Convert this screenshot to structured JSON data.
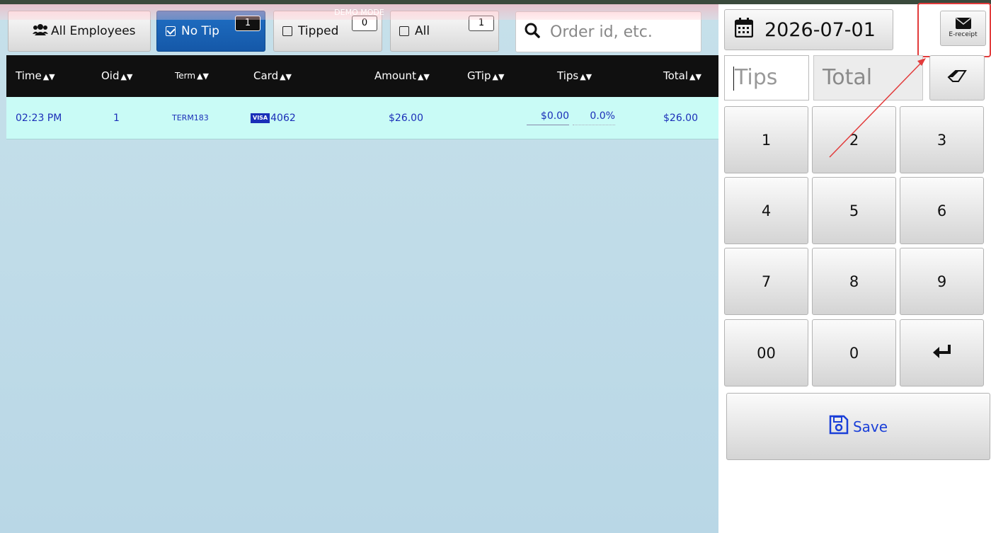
{
  "banner": {
    "text": "DEMO MODE"
  },
  "filters": {
    "all_employees": {
      "label": "All Employees"
    },
    "no_tip": {
      "label": "No Tip",
      "count": "1"
    },
    "tipped": {
      "label": "Tipped",
      "count": "0"
    },
    "all": {
      "label": "All",
      "count": "1"
    }
  },
  "search": {
    "placeholder": "Order id, etc."
  },
  "table": {
    "headers": [
      "Time",
      "Oid",
      "Term",
      "Card",
      "Amount",
      "GTip",
      "Tips",
      "Total"
    ],
    "rows": [
      {
        "time": "02:23 PM",
        "oid": "1",
        "term": "TERM183",
        "card_brand": "VISA",
        "card_last4": "4062",
        "amount": "$26.00",
        "gtip": "",
        "tips": "$0.00",
        "tip_percent": "0.0%",
        "total": "$26.00"
      }
    ]
  },
  "right_panel": {
    "date": "2026-07-01",
    "ereceipt_label": "E-receipt",
    "tips_placeholder": "Tips",
    "total_placeholder": "Total",
    "keypad": [
      "1",
      "2",
      "3",
      "4",
      "5",
      "6",
      "7",
      "8",
      "9",
      "00",
      "0",
      "enter"
    ],
    "save_label": "Save"
  },
  "icons": {
    "employees": "users-icon",
    "search": "search-icon",
    "calendar": "calendar-icon",
    "email": "envelope-icon",
    "eraser": "eraser-icon",
    "enter": "enter-icon",
    "save": "floppy-disk-icon"
  },
  "colors": {
    "accent_blue": "#1f6fc4",
    "highlight_red": "#e23b3b",
    "row_bg": "#c9fbf6",
    "row_text": "#1b2fb8"
  }
}
